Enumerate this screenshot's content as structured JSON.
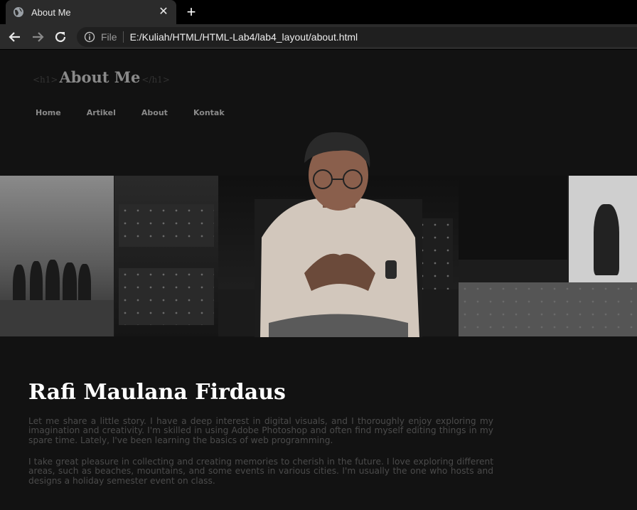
{
  "browser": {
    "tab_title": "About Me",
    "close_glyph": "✕",
    "new_tab_glyph": "+",
    "address_scheme_label": "File",
    "address_url": "E:/Kuliah/HTML/HTML-Lab4/lab4_layout/about.html"
  },
  "page": {
    "heading_open_tag": "<h1>",
    "heading_text": "About Me",
    "heading_close_tag": "</h1>",
    "nav": [
      "Home",
      "Artikel",
      "About",
      "Kontak"
    ],
    "name": "Rafi Maulana Firdaus",
    "paragraphs": [
      "Let me share a little story. I have a deep interest in digital visuals, and I thoroughly enjoy exploring my imagination and creativity. I'm skilled in using Adobe Photoshop and often find myself editing things in my spare time. Lately, I've been learning the basics of web programming.",
      "I take great pleasure in collecting and creating memories to cherish in the future. I love exploring different areas, such as beaches, mountains, and some events in various cities. I'm usually the one who hosts and designs a holiday semester event on class."
    ]
  },
  "colors": {
    "page_bg": "#121212",
    "heading_text": "#8a8a8a",
    "paragraph_text": "#4b4b4b",
    "name_text": "#ffffff"
  }
}
